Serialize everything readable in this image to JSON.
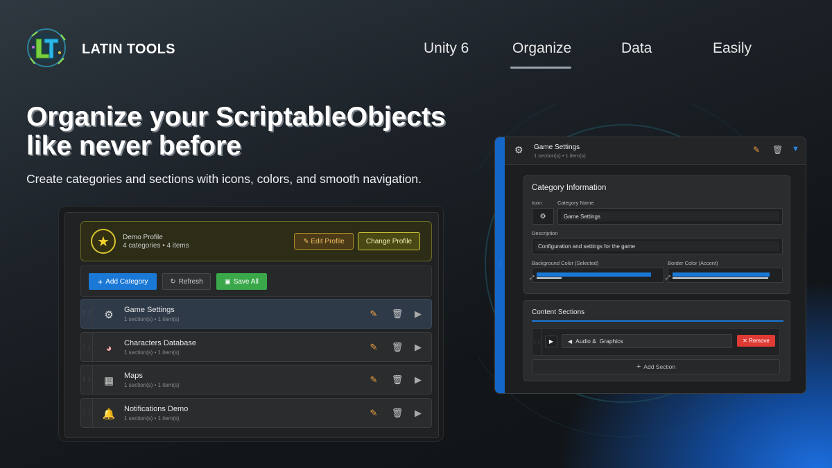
{
  "brand": {
    "name": "LATIN TOOLS"
  },
  "nav": {
    "items": [
      "Unity 6",
      "Organize",
      "Data",
      "Easily"
    ],
    "active": "Organize"
  },
  "hero": {
    "headline": "Organize your ScriptableObjects like never before",
    "subline": "Create categories and sections with icons, colors, and smooth navigation."
  },
  "profile": {
    "name": "Demo Profile",
    "meta": "4 categories • 4 items",
    "edit_label": "✎ Edit Profile",
    "change_label": "Change Profile"
  },
  "toolbar": {
    "add_label": "Add Category",
    "refresh_label": "Refresh",
    "save_label": "Save All"
  },
  "categories": [
    {
      "name": "Game Settings",
      "meta": "1 section(s) • 1 item(s)",
      "icon": "gear-icon"
    },
    {
      "name": "Characters Database",
      "meta": "1 section(s) • 1 item(s)",
      "icon": "character-icon"
    },
    {
      "name": "Maps",
      "meta": "1 section(s) • 1 item(s)",
      "icon": "map-icon"
    },
    {
      "name": "Notifications Demo",
      "meta": "1 section(s) • 1 item(s)",
      "icon": "bell-icon"
    }
  ],
  "detail": {
    "title": "Game Settings",
    "meta": "1 section(s) • 1 item(s)",
    "category_info_title": "Category Information",
    "icon_label": "Icon",
    "name_label": "Category Name",
    "name_value": "Game Settings",
    "description_label": "Description",
    "description_value": "Configuration and settings for the game",
    "bg_color_label": "Background Color (Selected)",
    "border_color_label": "Border Color (Accent)",
    "bg_color": "#1a78d6",
    "border_color": "#1a78d6",
    "content_title": "Content Sections",
    "section_name": "Audio &  Graphics",
    "remove_label": "✕ Remove",
    "add_section_label": "Add Section"
  },
  "colors": {
    "accent": "#1a78d6",
    "save_green": "#3aa84a",
    "remove_red": "#e03a34",
    "profile_yellow": "#d8c42e"
  }
}
